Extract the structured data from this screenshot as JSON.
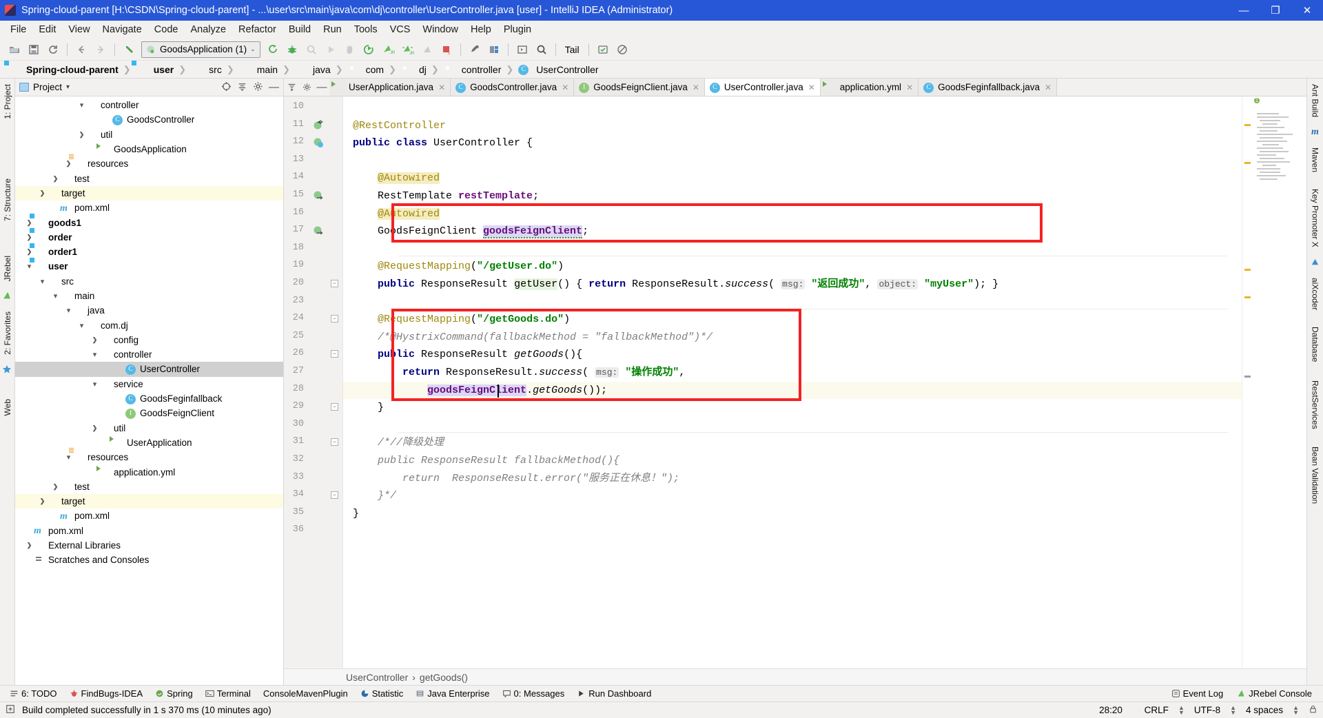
{
  "window": {
    "title": "Spring-cloud-parent [H:\\CSDN\\Spring-cloud-parent] - ...\\user\\src\\main\\java\\com\\dj\\controller\\UserController.java [user] - IntelliJ IDEA (Administrator)",
    "minimize": "—",
    "maximize": "❐",
    "close": "✕",
    "titlebar_color": "#2757d6"
  },
  "menu": [
    "File",
    "Edit",
    "View",
    "Navigate",
    "Code",
    "Analyze",
    "Refactor",
    "Build",
    "Run",
    "Tools",
    "VCS",
    "Window",
    "Help",
    "Plugin"
  ],
  "toolbar": {
    "run_config": "GoodsApplication (1)",
    "run_config_caret": "⌄",
    "tail_label": "Tail",
    "icons": [
      "open-icon",
      "save-icon",
      "sync-icon",
      "back-icon",
      "forward-icon",
      "undo-icon",
      "build-icon",
      "debug-icon",
      "coverage-icon",
      "run-icon",
      "stop-hand-icon",
      "rerun-icon",
      "jrebel-run-icon",
      "jrebel-debug-icon",
      "jrebel-disabled-icon",
      "stop-icon",
      "settings-icon",
      "project-structure-icon",
      "layout-icon",
      "search-icon"
    ]
  },
  "breadcrumbs": [
    {
      "label": "Spring-cloud-parent",
      "icon": "module-folder-icon",
      "bold": true
    },
    {
      "label": "user",
      "icon": "module-folder-icon",
      "bold": true
    },
    {
      "label": "src",
      "icon": "folder-icon",
      "bold": false
    },
    {
      "label": "main",
      "icon": "folder-icon",
      "bold": false
    },
    {
      "label": "java",
      "icon": "source-folder-icon",
      "bold": false
    },
    {
      "label": "com",
      "icon": "package-icon",
      "bold": false
    },
    {
      "label": "dj",
      "icon": "package-icon",
      "bold": false
    },
    {
      "label": "controller",
      "icon": "package-icon",
      "bold": false
    },
    {
      "label": "UserController",
      "icon": "class-icon",
      "bold": false
    }
  ],
  "left_rail": [
    "1: Project",
    "7: Structure",
    "JRebel",
    "2: Favorites",
    "Web"
  ],
  "right_rail": [
    "Ant Build",
    "Maven",
    "Key Promoter X",
    "aiXcoder",
    "Database",
    "RestServices",
    "Bean Validation"
  ],
  "project_panel": {
    "title": "Project",
    "title_caret": "▾",
    "tree": [
      {
        "indent": 4,
        "arrow": "open",
        "icon": "package-icon",
        "label": "controller",
        "bold": false,
        "state": "none"
      },
      {
        "indent": 6,
        "arrow": "none",
        "icon": "class-icon",
        "label": "GoodsController",
        "bold": false,
        "state": "none"
      },
      {
        "indent": 4,
        "arrow": "closed",
        "icon": "package-icon",
        "label": "util",
        "bold": false,
        "state": "none"
      },
      {
        "indent": 5,
        "arrow": "none",
        "icon": "spring-class-icon",
        "label": "GoodsApplication",
        "bold": false,
        "state": "none"
      },
      {
        "indent": 3,
        "arrow": "closed",
        "icon": "resources-icon",
        "label": "resources",
        "bold": false,
        "state": "none"
      },
      {
        "indent": 2,
        "arrow": "closed",
        "icon": "folder-icon",
        "label": "test",
        "bold": false,
        "state": "none"
      },
      {
        "indent": 1,
        "arrow": "closed",
        "icon": "target-icon",
        "label": "target",
        "bold": false,
        "state": "highlight"
      },
      {
        "indent": 2,
        "arrow": "none",
        "icon": "maven-icon",
        "label": "pom.xml",
        "bold": false,
        "state": "none"
      },
      {
        "indent": 0,
        "arrow": "closed",
        "icon": "module-icon",
        "label": "goods1",
        "bold": true,
        "state": "none"
      },
      {
        "indent": 0,
        "arrow": "closed",
        "icon": "module-icon",
        "label": "order",
        "bold": true,
        "state": "none"
      },
      {
        "indent": 0,
        "arrow": "closed",
        "icon": "module-icon",
        "label": "order1",
        "bold": true,
        "state": "none"
      },
      {
        "indent": 0,
        "arrow": "open",
        "icon": "module-icon",
        "label": "user",
        "bold": true,
        "state": "none"
      },
      {
        "indent": 1,
        "arrow": "open",
        "icon": "folder-icon",
        "label": "src",
        "bold": false,
        "state": "none"
      },
      {
        "indent": 2,
        "arrow": "open",
        "icon": "folder-icon",
        "label": "main",
        "bold": false,
        "state": "none"
      },
      {
        "indent": 3,
        "arrow": "open",
        "icon": "source-folder-icon",
        "label": "java",
        "bold": false,
        "state": "none"
      },
      {
        "indent": 4,
        "arrow": "open",
        "icon": "package-icon",
        "label": "com.dj",
        "bold": false,
        "state": "none"
      },
      {
        "indent": 5,
        "arrow": "closed",
        "icon": "package-icon",
        "label": "config",
        "bold": false,
        "state": "none"
      },
      {
        "indent": 5,
        "arrow": "open",
        "icon": "package-icon",
        "label": "controller",
        "bold": false,
        "state": "none"
      },
      {
        "indent": 7,
        "arrow": "none",
        "icon": "class-icon",
        "label": "UserController",
        "bold": false,
        "state": "selected"
      },
      {
        "indent": 5,
        "arrow": "open",
        "icon": "package-icon",
        "label": "service",
        "bold": false,
        "state": "none"
      },
      {
        "indent": 7,
        "arrow": "none",
        "icon": "class-icon",
        "label": "GoodsFeginfallback",
        "bold": false,
        "state": "none"
      },
      {
        "indent": 7,
        "arrow": "none",
        "icon": "interface-icon",
        "label": "GoodsFeignClient",
        "bold": false,
        "state": "none"
      },
      {
        "indent": 5,
        "arrow": "closed",
        "icon": "package-icon",
        "label": "util",
        "bold": false,
        "state": "none"
      },
      {
        "indent": 6,
        "arrow": "none",
        "icon": "spring-class-icon",
        "label": "UserApplication",
        "bold": false,
        "state": "none"
      },
      {
        "indent": 3,
        "arrow": "open",
        "icon": "resources-icon",
        "label": "resources",
        "bold": false,
        "state": "none"
      },
      {
        "indent": 5,
        "arrow": "none",
        "icon": "yaml-icon",
        "label": "application.yml",
        "bold": false,
        "state": "none"
      },
      {
        "indent": 2,
        "arrow": "closed",
        "icon": "folder-icon",
        "label": "test",
        "bold": false,
        "state": "none"
      },
      {
        "indent": 1,
        "arrow": "closed",
        "icon": "target-icon",
        "label": "target",
        "bold": false,
        "state": "highlight"
      },
      {
        "indent": 2,
        "arrow": "none",
        "icon": "maven-icon",
        "label": "pom.xml",
        "bold": false,
        "state": "none"
      },
      {
        "indent": 0,
        "arrow": "none",
        "icon": "maven-icon",
        "label": "pom.xml",
        "bold": false,
        "state": "none"
      },
      {
        "indent": 0,
        "arrow": "closed",
        "icon": "library-icon",
        "label": "External Libraries",
        "bold": false,
        "state": "none"
      },
      {
        "indent": 0,
        "arrow": "none",
        "icon": "scratches-icon",
        "label": "Scratches and Consoles",
        "bold": false,
        "state": "none"
      }
    ]
  },
  "editor": {
    "tabs": [
      {
        "label": "UserApplication.java",
        "icon": "spring-class-icon",
        "active": false,
        "close": "✕"
      },
      {
        "label": "GoodsController.java",
        "icon": "class-icon",
        "active": false,
        "close": "✕"
      },
      {
        "label": "GoodsFeignClient.java",
        "icon": "interface-icon",
        "active": false,
        "close": "✕"
      },
      {
        "label": "UserController.java",
        "icon": "class-icon",
        "active": true,
        "close": "✕"
      },
      {
        "label": "application.yml",
        "icon": "yaml-icon",
        "active": false,
        "close": "✕"
      },
      {
        "label": "GoodsFeginfallback.java",
        "icon": "class-icon",
        "active": false,
        "close": "✕"
      }
    ],
    "first_line_number": 10,
    "line_numbers": [
      10,
      11,
      12,
      13,
      14,
      15,
      16,
      17,
      18,
      19,
      20,
      23,
      24,
      25,
      26,
      27,
      28,
      29,
      30,
      31,
      32,
      33,
      34,
      35,
      36
    ],
    "code_lines": [
      {
        "n": 10,
        "text": ""
      },
      {
        "n": 11,
        "text": "@RestController"
      },
      {
        "n": 12,
        "text": "public class UserController {"
      },
      {
        "n": 13,
        "text": ""
      },
      {
        "n": 14,
        "text": "    @Autowired"
      },
      {
        "n": 15,
        "text": "    RestTemplate restTemplate;"
      },
      {
        "n": 16,
        "text": "    @Autowired"
      },
      {
        "n": 17,
        "text": "    GoodsFeignClient goodsFeignClient;"
      },
      {
        "n": 18,
        "text": ""
      },
      {
        "n": 19,
        "text": "    @RequestMapping(\"/getUser.do\")"
      },
      {
        "n": 20,
        "text": "    public ResponseResult getUser() { return ResponseResult.success( msg: \"返回成功\", object: \"myUser\"); }"
      },
      {
        "n": 23,
        "text": ""
      },
      {
        "n": 24,
        "text": "    @RequestMapping(\"/getGoods.do\")"
      },
      {
        "n": 25,
        "text": "    /*@HystrixCommand(fallbackMethod = \"fallbackMethod\")*/"
      },
      {
        "n": 26,
        "text": "    public ResponseResult getGoods(){"
      },
      {
        "n": 27,
        "text": "        return ResponseResult.success( msg: \"操作成功\","
      },
      {
        "n": 28,
        "text": "            goodsFeignClient.getGoods());"
      },
      {
        "n": 29,
        "text": "    }"
      },
      {
        "n": 30,
        "text": ""
      },
      {
        "n": 31,
        "text": "    /*//降级处理"
      },
      {
        "n": 32,
        "text": "    public ResponseResult fallbackMethod(){"
      },
      {
        "n": 33,
        "text": "        return  ResponseResult.error(\"服务正在休息！\");"
      },
      {
        "n": 34,
        "text": "    }*/"
      },
      {
        "n": 35,
        "text": "}"
      },
      {
        "n": 36,
        "text": ""
      }
    ],
    "breadcrumb_bottom": [
      "UserController",
      "getGoods()"
    ],
    "breadcrumb_bottom_sep": "›",
    "annotation_red_box_label": "red-highlight-rectangle"
  },
  "tool_windows": {
    "left": [
      {
        "label": "6: TODO",
        "icon": "todo-icon"
      },
      {
        "label": "FindBugs-IDEA",
        "icon": "findbugs-icon"
      },
      {
        "label": "Spring",
        "icon": "spring-icon"
      },
      {
        "label": "Terminal",
        "icon": "terminal-icon"
      },
      {
        "label": "ConsoleMavenPlugin",
        "icon": "maven-console-icon"
      },
      {
        "label": "Statistic",
        "icon": "statistic-icon"
      },
      {
        "label": "Java Enterprise",
        "icon": "java-enterprise-icon"
      },
      {
        "label": "0: Messages",
        "icon": "messages-icon"
      },
      {
        "label": "Run Dashboard",
        "icon": "run-dashboard-icon"
      }
    ],
    "right": [
      {
        "label": "Event Log",
        "icon": "event-log-icon"
      },
      {
        "label": "JRebel Console",
        "icon": "jrebel-icon"
      }
    ]
  },
  "status_bar": {
    "message": "Build completed successfully in 1 s 370 ms (10 minutes ago)",
    "caret_position": "28:20",
    "line_separator": "CRLF",
    "encoding": "UTF-8",
    "indent": "4 spaces",
    "lock_icon": "lock-icon"
  }
}
